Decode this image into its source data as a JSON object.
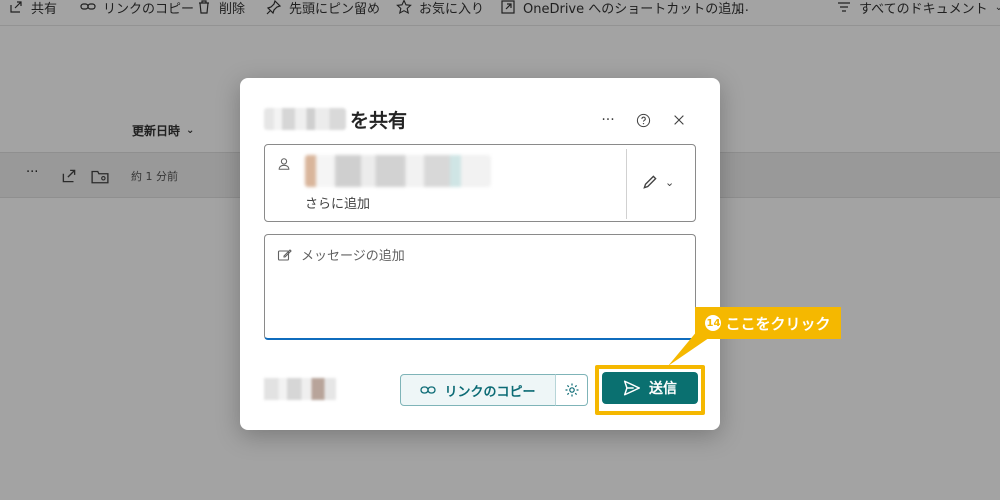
{
  "toolbar": {
    "items": [
      {
        "label": "共有",
        "icon": "share-icon"
      },
      {
        "label": "リンクのコピー",
        "icon": "link-icon"
      },
      {
        "label": "削除",
        "icon": "trash-icon"
      },
      {
        "label": "先頭にピン留め",
        "icon": "pin-icon"
      },
      {
        "label": "お気に入り",
        "icon": "star-icon"
      },
      {
        "label": "OneDrive へのショートカットの追加",
        "icon": "shortcut-icon"
      },
      {
        "label": "…",
        "icon": "more-icon"
      }
    ],
    "view_label": "すべてのドキュメント"
  },
  "list": {
    "sort_header": "更新日時",
    "row_modified": "約 1 分前"
  },
  "dialog": {
    "title": "を共有",
    "add_more": "さらに追加",
    "message_placeholder": "メッセージの追加",
    "copy_link_label": "リンクのコピー",
    "send_label": "送信"
  },
  "annotation": {
    "step_number": "14",
    "text": "ここをクリック",
    "color": "#f5b800"
  },
  "colors": {
    "accent": "#0a7070",
    "highlight": "#f5b800"
  }
}
